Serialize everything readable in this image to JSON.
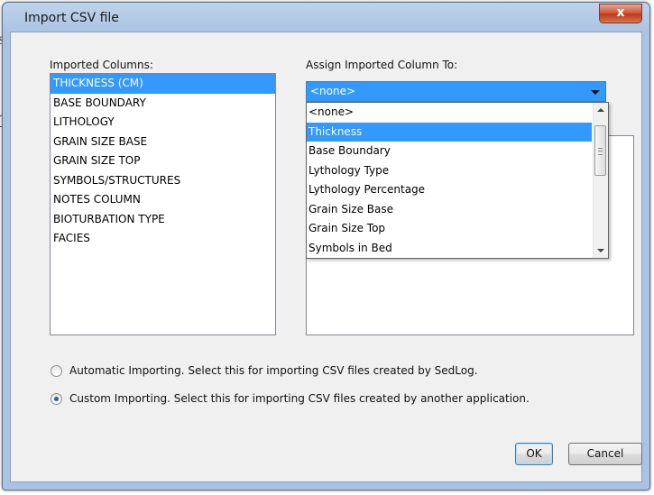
{
  "window": {
    "title": "Import CSV file",
    "close_label": "x"
  },
  "imported_columns": {
    "label": "Imported Columns:",
    "items": [
      "THICKNESS (CM)",
      "BASE BOUNDARY",
      "LITHOLOGY",
      "GRAIN SIZE BASE",
      "GRAIN SIZE TOP",
      "SYMBOLS/STRUCTURES",
      "NOTES COLUMN",
      "BIOTURBATION TYPE",
      "FACIES"
    ],
    "selected": "THICKNESS (CM)"
  },
  "assign": {
    "label": "Assign Imported Column To:",
    "selected_value": "<none>",
    "options": [
      "<none>",
      "Thickness",
      "Base Boundary",
      "Lythology Type",
      "Lythology Percentage",
      "Grain Size Base",
      "Grain Size Top",
      "Symbols in Bed"
    ],
    "highlighted": "Thickness"
  },
  "radios": {
    "automatic_label": "Automatic Importing. Select this for importing CSV files created by SedLog.",
    "custom_label": "Custom Importing. Select this for importing CSV files created by another application.",
    "checked": "custom"
  },
  "buttons": {
    "ok": "OK",
    "cancel": "Cancel"
  },
  "background_edge": {
    "char1": "s",
    "char2": "1",
    "char3": "s"
  },
  "colors": {
    "selection": "#3399ff",
    "close_button": "#c0391b",
    "window_frame": "#a9c3e1"
  }
}
